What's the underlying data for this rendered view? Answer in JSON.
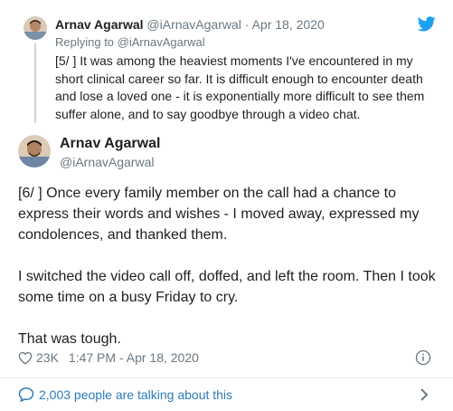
{
  "parent_tweet": {
    "author_name": "Arnav Agarwal",
    "author_handle": "@iArnavAgarwal",
    "separator": "·",
    "date": "Apr 18, 2020",
    "replying_to": "Replying to @iArnavAgarwal",
    "text": "[5/ ] It was among the heaviest moments I've encountered in my short clinical career so far. It is difficult enough to encounter death and lose a loved one - it is exponentially more difficult to see them suffer alone, and to say goodbye through a video chat."
  },
  "main_tweet": {
    "author_name": "Arnav Agarwal",
    "author_handle": "@iArnavAgarwal",
    "paragraphs": {
      "p1": "[6/ ] Once every family member on the call had a chance to express their words and wishes - I moved away, expressed my condolences, and thanked them.",
      "p2": "I switched the video call off, doffed, and left the room. Then I took some time on a busy Friday to cry.",
      "p3": "That was tough."
    },
    "like_count": "23K",
    "timestamp": "1:47 PM - Apr 18, 2020"
  },
  "footer": {
    "talking_label": "2,003 people are talking about this"
  },
  "icons": {
    "brand": "twitter-bird-icon",
    "like": "heart-icon",
    "info": "info-icon",
    "conversation": "speech-bubble-icon",
    "more": "chevron-right-icon"
  },
  "colors": {
    "twitter_blue": "#1da1f2",
    "link_blue": "#2b7bb9",
    "secondary_text": "#697882",
    "primary_text": "#1c2022",
    "divider": "#e1e8ed"
  }
}
